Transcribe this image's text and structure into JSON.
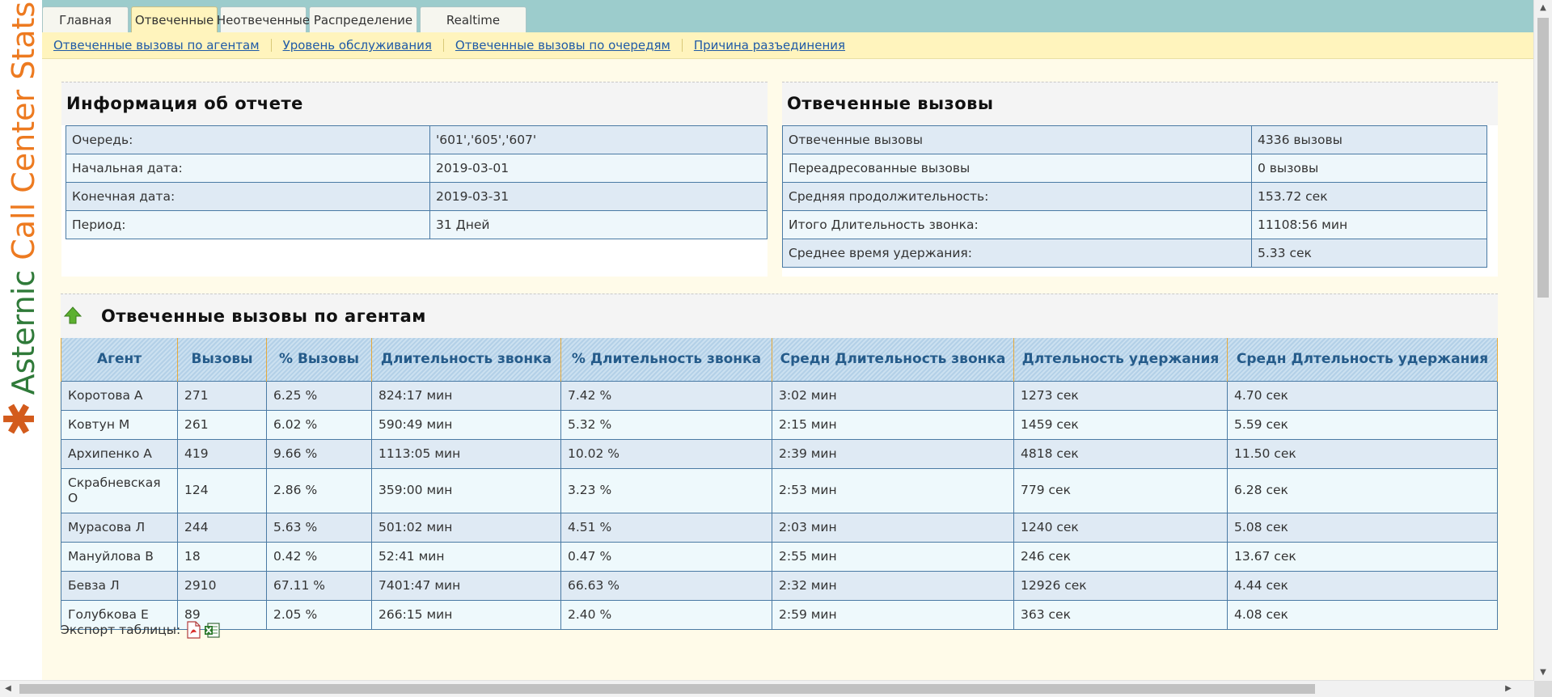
{
  "brand": {
    "star": "✱",
    "word1": "Asternic",
    "word2": "Call Center Stats"
  },
  "tabs": [
    {
      "label": "Главная",
      "active": false
    },
    {
      "label": "Отвеченные",
      "active": true
    },
    {
      "label": "Неотвеченные",
      "active": false
    },
    {
      "label": "Распределение",
      "active": false
    },
    {
      "label": "Realtime",
      "active": false
    }
  ],
  "subnav": [
    "Отвеченные вызовы по агентам",
    "Уровень обслуживания",
    "Отвеченные вызовы по очередям",
    "Причина разъединения"
  ],
  "report_info": {
    "title": "Информация об отчете",
    "rows": [
      [
        "Очередь:",
        "'601','605','607'"
      ],
      [
        "Начальная дата:",
        "2019-03-01"
      ],
      [
        "Конечная дата:",
        "2019-03-31"
      ],
      [
        "Период:",
        "31 Дней"
      ]
    ]
  },
  "answered": {
    "title": "Отвеченные вызовы",
    "rows": [
      [
        "Отвеченные вызовы",
        "4336 вызовы"
      ],
      [
        "Переадресованные вызовы",
        "0 вызовы"
      ],
      [
        "Средняя продолжительность:",
        "153.72 сек"
      ],
      [
        "Итого Длительность звонка:",
        "11108:56 мин"
      ],
      [
        "Среднее время удержания:",
        "5.33 сек"
      ]
    ]
  },
  "agents": {
    "title": "Отвеченные вызовы по агентам",
    "headers": [
      "Агент",
      "Вызовы",
      "% Вызовы",
      "Длительность звонка",
      "% Длительность звонка",
      "Средн Длительность звонка",
      "Длтельность удержания",
      "Средн Длтельность удержания"
    ],
    "rows": [
      [
        "Коротова А",
        "271",
        "6.25 %",
        "824:17 мин",
        "7.42 %",
        "3:02 мин",
        "1273 сек",
        "4.70 сек"
      ],
      [
        "Ковтун М",
        "261",
        "6.02 %",
        "590:49 мин",
        "5.32 %",
        "2:15 мин",
        "1459 сек",
        "5.59 сек"
      ],
      [
        "Архипенко А",
        "419",
        "9.66 %",
        "1113:05 мин",
        "10.02 %",
        "2:39 мин",
        "4818 сек",
        "11.50 сек"
      ],
      [
        "Скрабневская О",
        "124",
        "2.86 %",
        "359:00 мин",
        "3.23 %",
        "2:53 мин",
        "779 сек",
        "6.28 сек"
      ],
      [
        "Мурасова Л",
        "244",
        "5.63 %",
        "501:02 мин",
        "4.51 %",
        "2:03 мин",
        "1240 сек",
        "5.08 сек"
      ],
      [
        "Мануйлова В",
        "18",
        "0.42 %",
        "52:41 мин",
        "0.47 %",
        "2:55 мин",
        "246 сек",
        "13.67 сек"
      ],
      [
        "Бевза Л",
        "2910",
        "67.11 %",
        "7401:47 мин",
        "66.63 %",
        "2:32 мин",
        "12926 сек",
        "4.44 сек"
      ],
      [
        "Голубкова Е",
        "89",
        "2.05 %",
        "266:15 мин",
        "2.40 %",
        "2:59 мин",
        "363 сек",
        "4.08 сек"
      ]
    ]
  },
  "export": {
    "label": "Экспорт таблицы:"
  }
}
